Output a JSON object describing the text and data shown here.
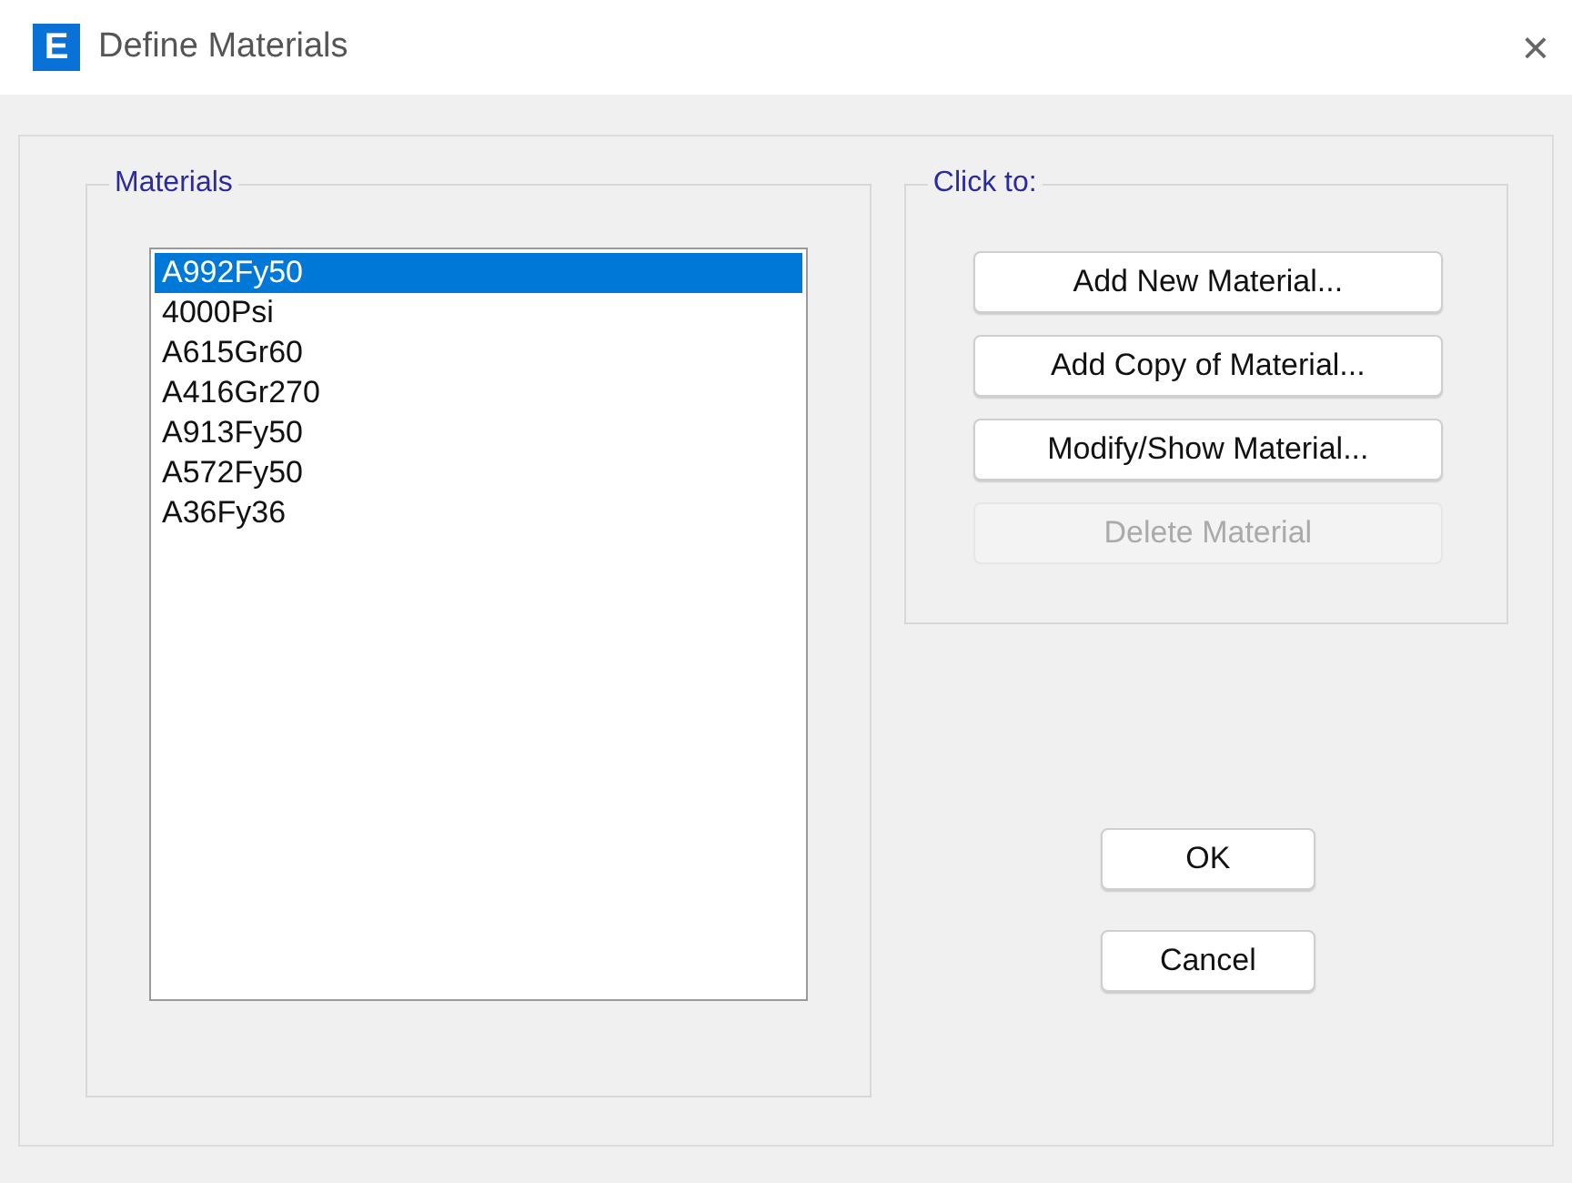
{
  "window": {
    "app_icon": "E",
    "title": "Define Materials",
    "close": "×"
  },
  "materials": {
    "label": "Materials",
    "items": [
      {
        "name": "A992Fy50",
        "selected": true
      },
      {
        "name": "4000Psi",
        "selected": false
      },
      {
        "name": "A615Gr60",
        "selected": false
      },
      {
        "name": "A416Gr270",
        "selected": false
      },
      {
        "name": "A913Fy50",
        "selected": false
      },
      {
        "name": "A572Fy50",
        "selected": false
      },
      {
        "name": "A36Fy36",
        "selected": false
      }
    ]
  },
  "actions": {
    "label": "Click to:",
    "buttons": [
      {
        "label": "Add New Material...",
        "disabled": false
      },
      {
        "label": "Add Copy of Material...",
        "disabled": false
      },
      {
        "label": "Modify/Show Material...",
        "disabled": false
      },
      {
        "label": "Delete Material",
        "disabled": true
      }
    ]
  },
  "buttons": [
    "OK",
    "Cancel"
  ]
}
